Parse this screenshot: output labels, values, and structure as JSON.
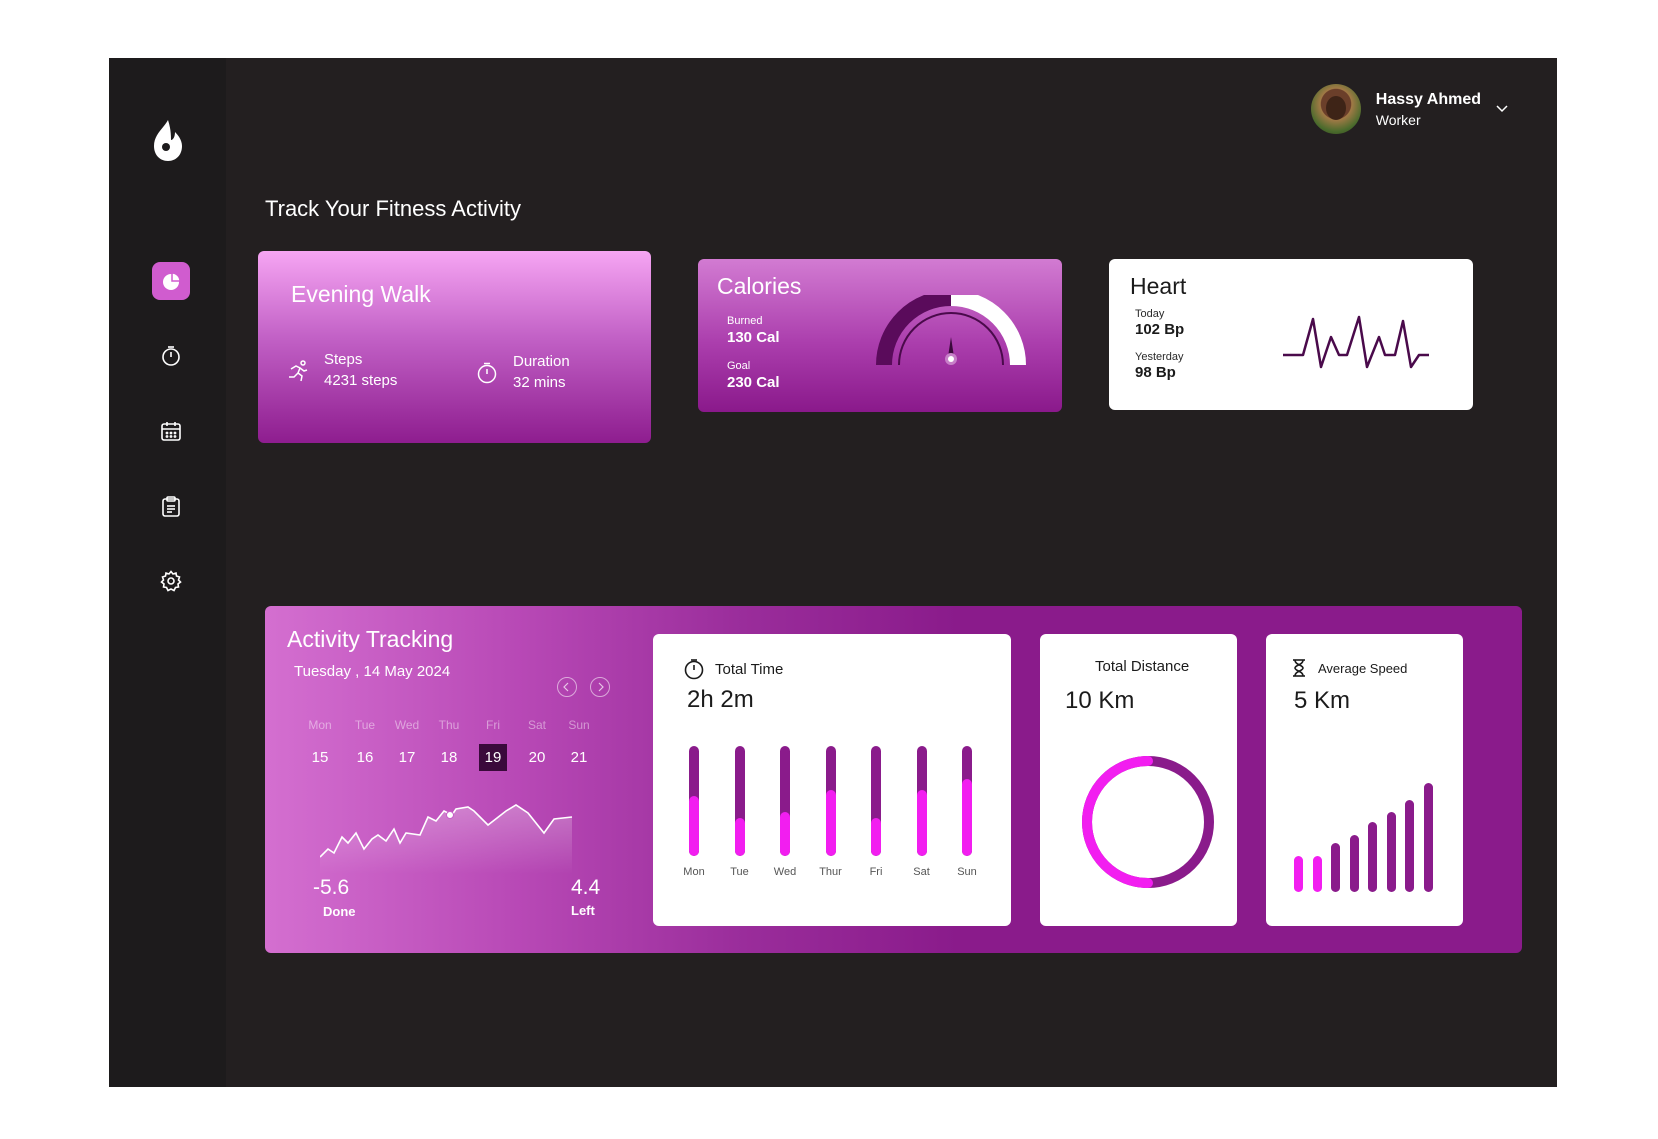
{
  "user": {
    "name": "Hassy Ahmed",
    "role": "Worker"
  },
  "page_title": "Track Your Fitness Activity",
  "nav": [
    {
      "icon": "pie-chart-icon",
      "active": true
    },
    {
      "icon": "stopwatch-icon",
      "active": false
    },
    {
      "icon": "calendar-icon",
      "active": false
    },
    {
      "icon": "clipboard-icon",
      "active": false
    },
    {
      "icon": "gear-icon",
      "active": false
    }
  ],
  "evening_walk": {
    "title": "Evening Walk",
    "steps_label": "Steps",
    "steps_value": "4231 steps",
    "duration_label": "Duration",
    "duration_value": "32 mins"
  },
  "calories": {
    "title": "Calories",
    "burned_label": "Burned",
    "burned_value": "130 Cal",
    "goal_label": "Goal",
    "goal_value": "230 Cal",
    "gauge_fraction": 0.5
  },
  "heart": {
    "title": "Heart",
    "today_label": "Today",
    "today_value": "102 Bp",
    "yesterday_label": "Yesterday",
    "yesterday_value": "98 Bp"
  },
  "activity": {
    "title": "Activity Tracking",
    "date": "Tuesday , 14 May 2024",
    "days": [
      {
        "name": "Mon",
        "num": "15"
      },
      {
        "name": "Tue",
        "num": "16"
      },
      {
        "name": "Wed",
        "num": "17"
      },
      {
        "name": "Thu",
        "num": "18"
      },
      {
        "name": "Fri",
        "num": "19"
      },
      {
        "name": "Sat",
        "num": "20"
      },
      {
        "name": "Sun",
        "num": "21"
      }
    ],
    "selected_day": "19",
    "done_value": "-5.6",
    "done_label": "Done",
    "left_value": "4.4",
    "left_label": "Left"
  },
  "total_time": {
    "label": "Total Time",
    "value": "2h  2m",
    "chart_data": {
      "type": "bar",
      "categories": [
        "Mon",
        "Tue",
        "Wed",
        "Thur",
        "Fri",
        "Sat",
        "Sun"
      ],
      "values": [
        0.55,
        0.35,
        0.4,
        0.6,
        0.35,
        0.6,
        0.7
      ]
    }
  },
  "total_distance": {
    "label": "Total Distance",
    "value": "10 Km",
    "ring_fraction": 0.5
  },
  "average_speed": {
    "label": "Average Speed",
    "value": "5 Km",
    "chart_data": {
      "type": "bar",
      "values": [
        0.33,
        0.33,
        0.45,
        0.52,
        0.64,
        0.73,
        0.84,
        0.99
      ]
    }
  },
  "colors": {
    "accent": "#f21ef0",
    "purple": "#8a1b8b",
    "background": "#231f20",
    "sidebar": "#1d1b1c"
  }
}
